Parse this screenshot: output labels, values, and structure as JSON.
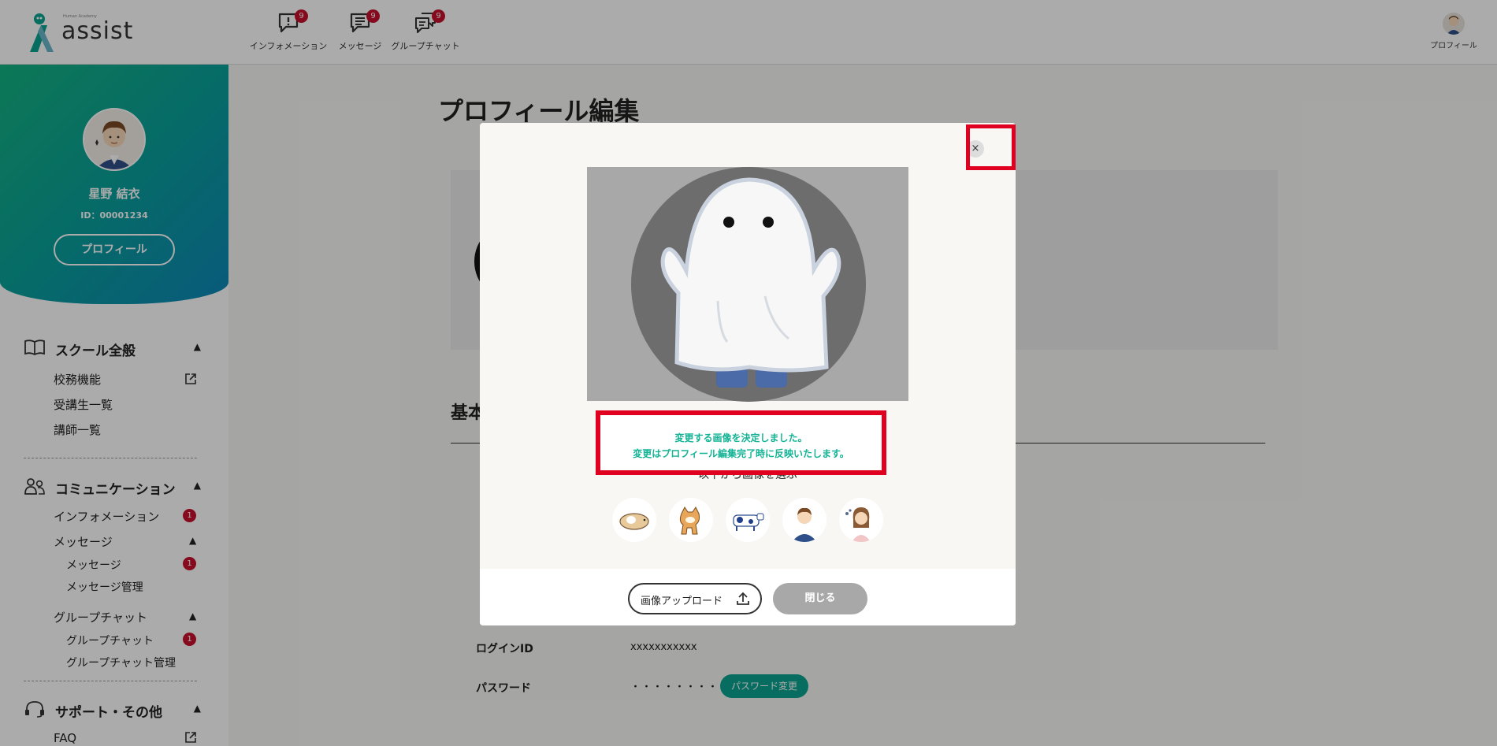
{
  "header": {
    "logo_text": "assist",
    "logo_sub": "Human Academy",
    "nav": [
      {
        "label": "インフォメーション",
        "badge": "9",
        "icon": "info-bubble-icon"
      },
      {
        "label": "メッセージ",
        "badge": "9",
        "icon": "message-bubble-icon"
      },
      {
        "label": "グループチャット",
        "badge": "9",
        "icon": "group-chat-icon"
      }
    ],
    "profile_label": "プロフィール"
  },
  "sidebar": {
    "user_name": "星野 結衣",
    "user_id": "ID：00001234",
    "profile_button": "プロフィール",
    "sections": [
      {
        "title": "スクール全般",
        "icon": "book-icon",
        "items": [
          "校務機能",
          "受講生一覧",
          "講師一覧"
        ]
      },
      {
        "title": "コミュニケーション",
        "icon": "users-icon",
        "items": [
          "インフォメーション"
        ],
        "info_badge": "1",
        "subgroups": [
          {
            "title": "メッセージ",
            "items": [
              "メッセージ",
              "メッセージ管理"
            ],
            "badge": "1"
          },
          {
            "title": "グループチャット",
            "items": [
              "グループチャット",
              "グループチャット管理"
            ],
            "badge": "1"
          }
        ]
      },
      {
        "title": "サポート・その他",
        "icon": "headset-icon",
        "items": [
          "FAQ"
        ]
      }
    ]
  },
  "main": {
    "page_title": "プロフィール編集",
    "basic_heading": "基本",
    "login_id_label": "ログインID",
    "login_id_value": "xxxxxxxxxxx",
    "password_label": "パスワード",
    "password_value": "・・・・・・・・",
    "password_button": "パスワード変更"
  },
  "modal": {
    "close_icon": "×",
    "choose_label": "以下から画像を選ぶ",
    "samples": [
      "guinea-pig-icon",
      "shiba-dog-icon",
      "cow-icon",
      "businessman-icon",
      "woman-icon"
    ],
    "notice_line1": "変更する画像を決定しました。",
    "notice_line2": "変更はプロフィール編集完了時に反映いたします。",
    "upload_button": "画像アップロード",
    "close_button": "閉じる"
  },
  "colors": {
    "accent": "#0aa38f",
    "badge": "#c8102e",
    "highlight": "#e00020",
    "notice_text": "#14b395"
  }
}
